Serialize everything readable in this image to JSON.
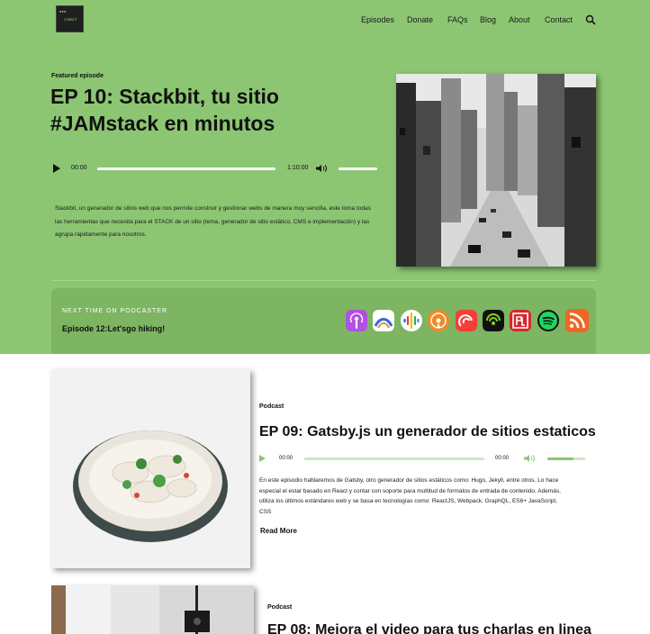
{
  "header": {
    "logo_text": "commit",
    "nav": [
      "Episodes",
      "Donate",
      "FAQs",
      "Blog",
      "About",
      "Contact"
    ],
    "search_icon": "search-icon"
  },
  "featured": {
    "label": "Featured episode",
    "title": "EP 10: Stackbit, tu sitio #JAMstack en minutos",
    "player": {
      "current_time": "00:00",
      "duration": "1:10:00",
      "progress": 0,
      "volume": 1.0
    },
    "description": "Stackbit, un generador de sitios web que nos permite construir y gestionar webs de manera muy sencilla, este toma todas las herramientas que necesita para el STACK de un sitio (tema, generador de sitio estático, CMS e implementación) y las agrupa rápidamente para nosotros."
  },
  "next": {
    "label": "NEXT TIME ON PODCASTER",
    "title": "Episode 12:Let'sgo hiking!",
    "platforms": [
      {
        "icon": "apple-podcasts-icon",
        "color": "#b150e2"
      },
      {
        "icon": "podcast-addict-icon",
        "color": "#2f6fd1"
      },
      {
        "icon": "google-podcasts-icon",
        "color": "#ffffff"
      },
      {
        "icon": "overcast-icon",
        "color": "#f08a24"
      },
      {
        "icon": "pocket-casts-icon",
        "color": "#f43e37"
      },
      {
        "icon": "castbox-icon",
        "color": "#111111"
      },
      {
        "icon": "player-fm-icon",
        "color": "#d7262b"
      },
      {
        "icon": "spotify-icon",
        "color": "#1ed760"
      },
      {
        "icon": "rss-icon",
        "color": "#f26522"
      }
    ]
  },
  "episodes": [
    {
      "label": "Podcast",
      "title": "EP 09: Gatsby.js un generador de sitios estaticos",
      "player": {
        "current_time": "00:00",
        "duration": "00:00",
        "progress": 0,
        "volume": 0.7
      },
      "description": "En este episodio hablaremos de Gatsby, otro generador de sitios estáticos como: Hugo, Jekyll, entre otros. Lo hace especial el estar basado en React y contar con soporte para multitud de formatos de entrada de contenido. Además, utiliza los últimos estándares web y se basa en tecnologías como: ReactJS, Webpack, GraphQL, ES6+ JavaScript, CSS",
      "read_more": "Read More"
    },
    {
      "label": "Podcast",
      "title": "EP 08: Mejora el video para tus charlas en linea"
    }
  ],
  "colors": {
    "hero_bg": "#8cc672",
    "accent": "#8cc672",
    "next_bg": "#7db562"
  }
}
